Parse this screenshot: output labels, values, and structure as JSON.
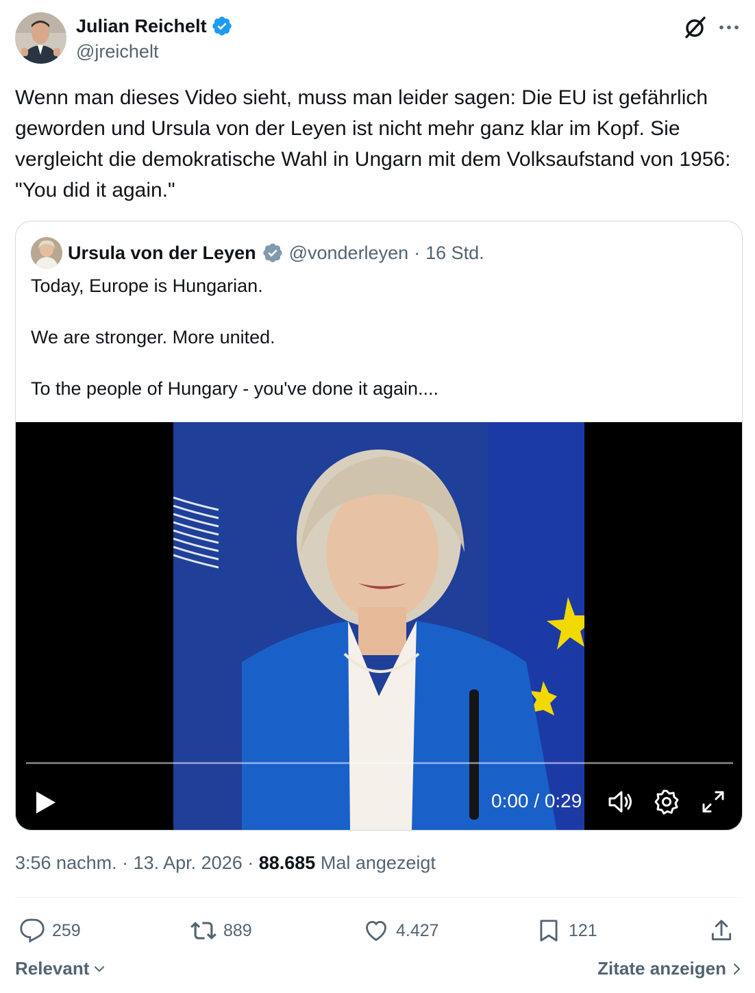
{
  "author": {
    "name": "Julian Reichelt",
    "handle": "@jreichelt",
    "verified_color": "#1d9bf0"
  },
  "tweet": {
    "text": "Wenn man dieses Video sieht, muss man leider sagen: Die EU ist gefährlich geworden und Ursula von der Leyen ist nicht mehr ganz klar im Kopf. Sie vergleicht die demokratische Wahl in Ungarn mit dem Volksaufstand von 1956: \"You did it again.\""
  },
  "quoted": {
    "name": "Ursula von der Leyen",
    "handle": "@vonderleyen",
    "separator": "·",
    "age": "16 Std.",
    "verified_color": "#829aab",
    "text": "Today, Europe is Hungarian.\n\nWe are stronger. More united.\n\nTo the people of Hungary - you've done it again....",
    "video": {
      "time": "0:00 / 0:29",
      "progress": 0
    }
  },
  "meta": {
    "timestamp": "3:56 nachm. · 13. Apr. 2026 · ",
    "views_count": "88.685",
    "views_label": " Mal angezeigt"
  },
  "actions": {
    "replies": "259",
    "reposts": "889",
    "likes": "4.427",
    "bookmarks": "121"
  },
  "footer": {
    "sort_label": "Relevant",
    "quotes_label": "Zitate anzeigen"
  },
  "icons": [
    "grok-icon",
    "more-icon",
    "verified-badge-icon",
    "play-icon",
    "volume-icon",
    "settings-icon",
    "fullscreen-icon",
    "reply-icon",
    "repost-icon",
    "like-icon",
    "bookmark-icon",
    "share-icon",
    "chevron-down-icon",
    "chevron-right-icon"
  ]
}
